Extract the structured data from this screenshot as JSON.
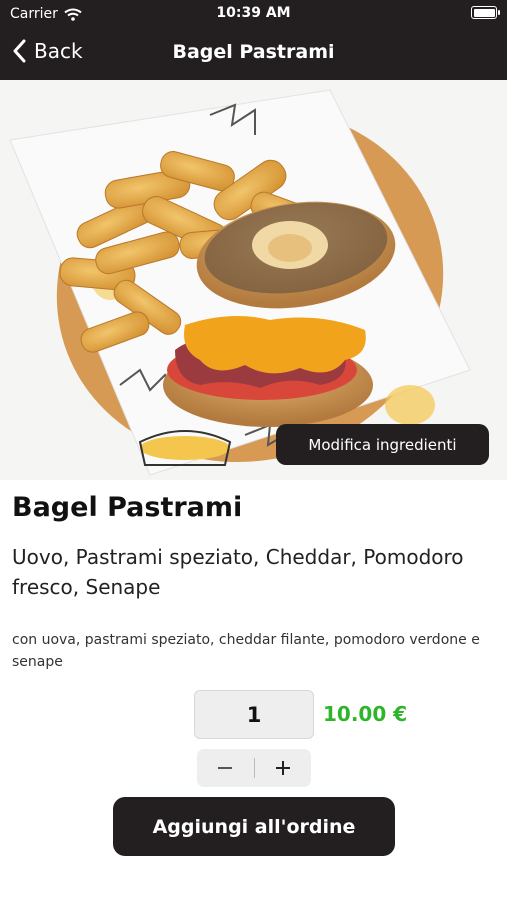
{
  "status_bar": {
    "carrier": "Carrier",
    "time": "10:39 AM",
    "wifi_icon": "wifi-icon",
    "battery_icon": "battery-icon"
  },
  "nav": {
    "back_label": "Back",
    "back_icon": "chevron-left-icon",
    "title": "Bagel Pastrami"
  },
  "hero": {
    "image": "bagel-pastrami-with-fries-photo",
    "edit_ingredients_label": "Modifica ingredienti"
  },
  "product": {
    "name": "Bagel Pastrami",
    "ingredients": "Uovo, Pastrami speziato, Cheddar, Pomodoro fresco, Senape",
    "description": "con uova, pastrami speziato, cheddar filante, pomodoro verdone e senape",
    "quantity": "1",
    "price": "10.00 €"
  },
  "stepper": {
    "minus_icon": "minus-icon",
    "plus_icon": "plus-icon"
  },
  "actions": {
    "add_to_order_label": "Aggiungi all'ordine"
  },
  "colors": {
    "bar_background": "#231f20",
    "price_green": "#2fb52b",
    "control_background": "#eeeeee"
  }
}
